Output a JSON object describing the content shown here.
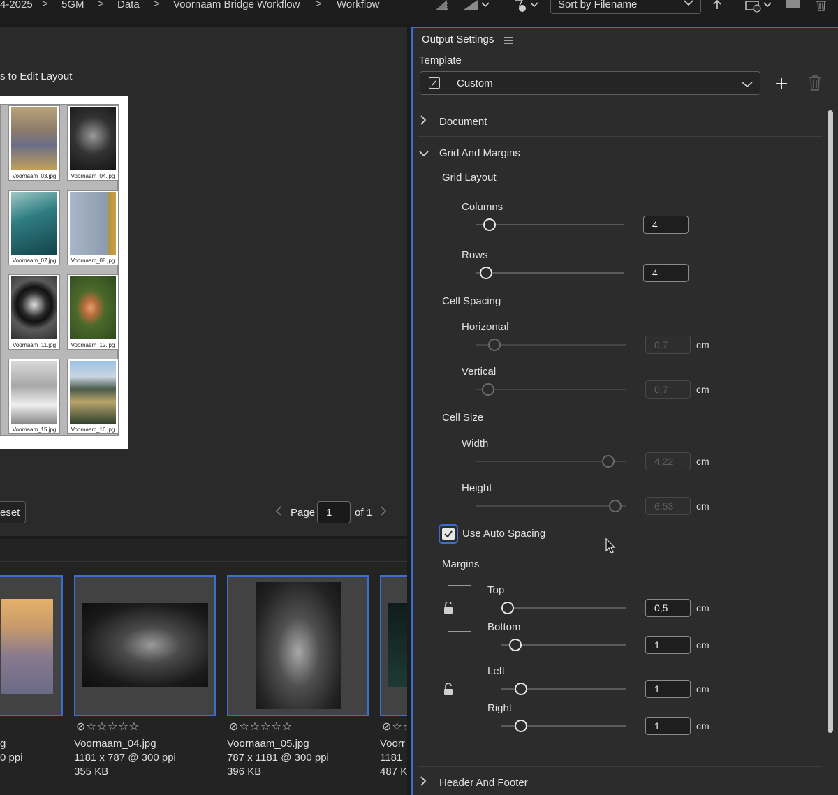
{
  "breadcrumb": {
    "items": [
      "4-2025",
      "5GM",
      "Data",
      "Voornaam Bridge Workflow",
      "Workflow"
    ],
    "separator": ">"
  },
  "toolbar": {
    "sort_label": "Sort by Filename",
    "icons": [
      "quality-icon",
      "thumbnail-quality-icon",
      "filter-star-icon",
      "sort-direction-icon",
      "recent-folder-icon",
      "new-folder-icon",
      "trash-icon"
    ]
  },
  "preview": {
    "edit_hint": "s to Edit Layout",
    "cells": [
      {
        "caption": "Voornaam_03.jpg"
      },
      {
        "caption": "Voornaam_04.jpg"
      },
      {
        "caption": "Voornaam_07.jpg"
      },
      {
        "caption": "Voornaam_08.jpg"
      },
      {
        "caption": "Voornaam_11.jpg"
      },
      {
        "caption": "Voornaam_12.jpg"
      },
      {
        "caption": "Voornaam_15.jpg"
      },
      {
        "caption": "Voornaam_16.jpg"
      }
    ],
    "reset_label": "eset",
    "page_label": "Page",
    "page_value": "1",
    "page_of": "of 1"
  },
  "filmstrip": {
    "items": [
      {
        "name": "g",
        "dims": "0 ppi",
        "size": ""
      },
      {
        "name": "Voornaam_04.jpg",
        "dims": "1181 x 787 @ 300 ppi",
        "size": "355 KB"
      },
      {
        "name": "Voornaam_05.jpg",
        "dims": "787 x 1181 @ 300 ppi",
        "size": "396 KB"
      },
      {
        "name": "Voorr",
        "dims": "1181",
        "size": "487 K"
      }
    ],
    "rating_glyphs": "⊘☆☆☆☆☆"
  },
  "panel": {
    "title": "Output Settings",
    "template_label": "Template",
    "template_value": "Custom",
    "sections": {
      "document": "Document",
      "grid_and_margins": "Grid And Margins",
      "header_footer": "Header And Footer"
    },
    "grid_layout": {
      "label": "Grid Layout",
      "columns_label": "Columns",
      "columns_value": "4",
      "rows_label": "Rows",
      "rows_value": "4"
    },
    "cell_spacing": {
      "label": "Cell Spacing",
      "horizontal_label": "Horizontal",
      "horizontal_value": "0,7",
      "vertical_label": "Vertical",
      "vertical_value": "0,7"
    },
    "cell_size": {
      "label": "Cell Size",
      "width_label": "Width",
      "width_value": "4,22",
      "height_label": "Height",
      "height_value": "6,53"
    },
    "auto_spacing": {
      "label": "Use Auto Spacing",
      "checked": true
    },
    "margins": {
      "label": "Margins",
      "top_label": "Top",
      "top_value": "0,5",
      "bottom_label": "Bottom",
      "bottom_value": "1",
      "left_label": "Left",
      "left_value": "1",
      "right_label": "Right",
      "right_value": "1"
    },
    "unit": "cm"
  },
  "colors": {
    "accent": "#3a6fd1",
    "panel_bg": "#2c2c2c",
    "app_bg": "#1b1b1b"
  }
}
